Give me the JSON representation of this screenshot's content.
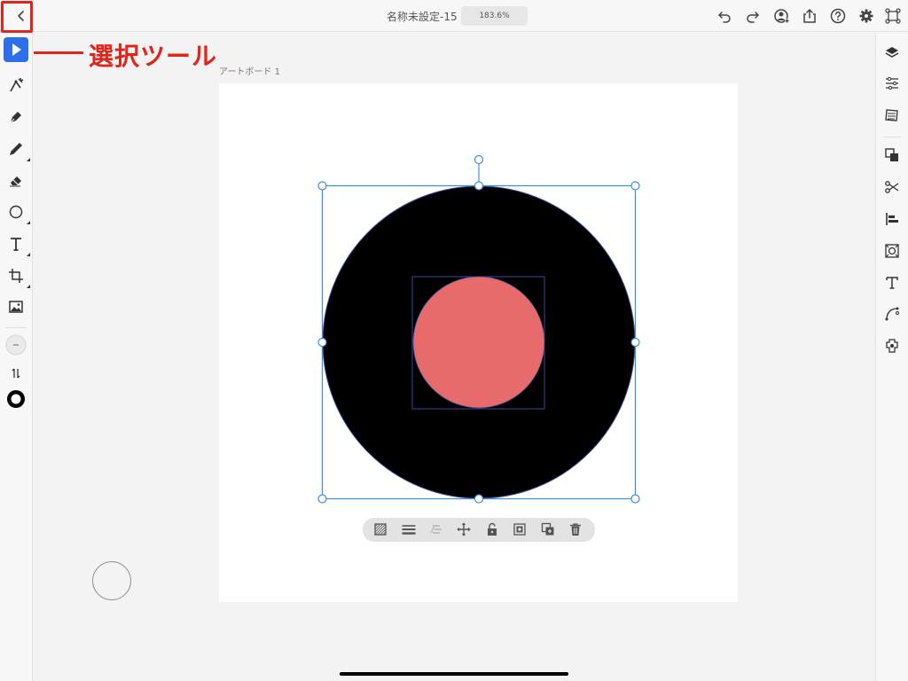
{
  "header": {
    "title": "名称未設定-15",
    "zoom": "183.6%"
  },
  "annotation": {
    "label": "選択ツール",
    "color": "#e0251b"
  },
  "canvas": {
    "artboard_label": "アートボード 1",
    "shapes": {
      "outer_circle_color": "#000000",
      "inner_circle_color": "#e86b6b",
      "selection_color": "#3a8ee6"
    }
  },
  "left_toolbar": {
    "tools": [
      "select-tool",
      "direct-select-tool",
      "pen-tool",
      "pencil-tool",
      "eraser-tool",
      "ellipse-tool",
      "text-tool",
      "transform-tool",
      "image-tool"
    ],
    "active_tool": "select-tool",
    "accent": "#2d6fe6"
  },
  "right_toolbar": {
    "icons": [
      "layers-icon",
      "properties-icon",
      "libraries-icon",
      "arrange-icon",
      "cut-icon",
      "align-icon",
      "repeat-grid-icon",
      "text-style-icon",
      "path-icon",
      "plugins-icon"
    ]
  },
  "context_bar": {
    "icons": [
      "fill-icon",
      "stroke-icon",
      "effects-icon",
      "move-icon",
      "lock-icon",
      "mask-icon",
      "duplicate-icon",
      "delete-icon"
    ]
  }
}
